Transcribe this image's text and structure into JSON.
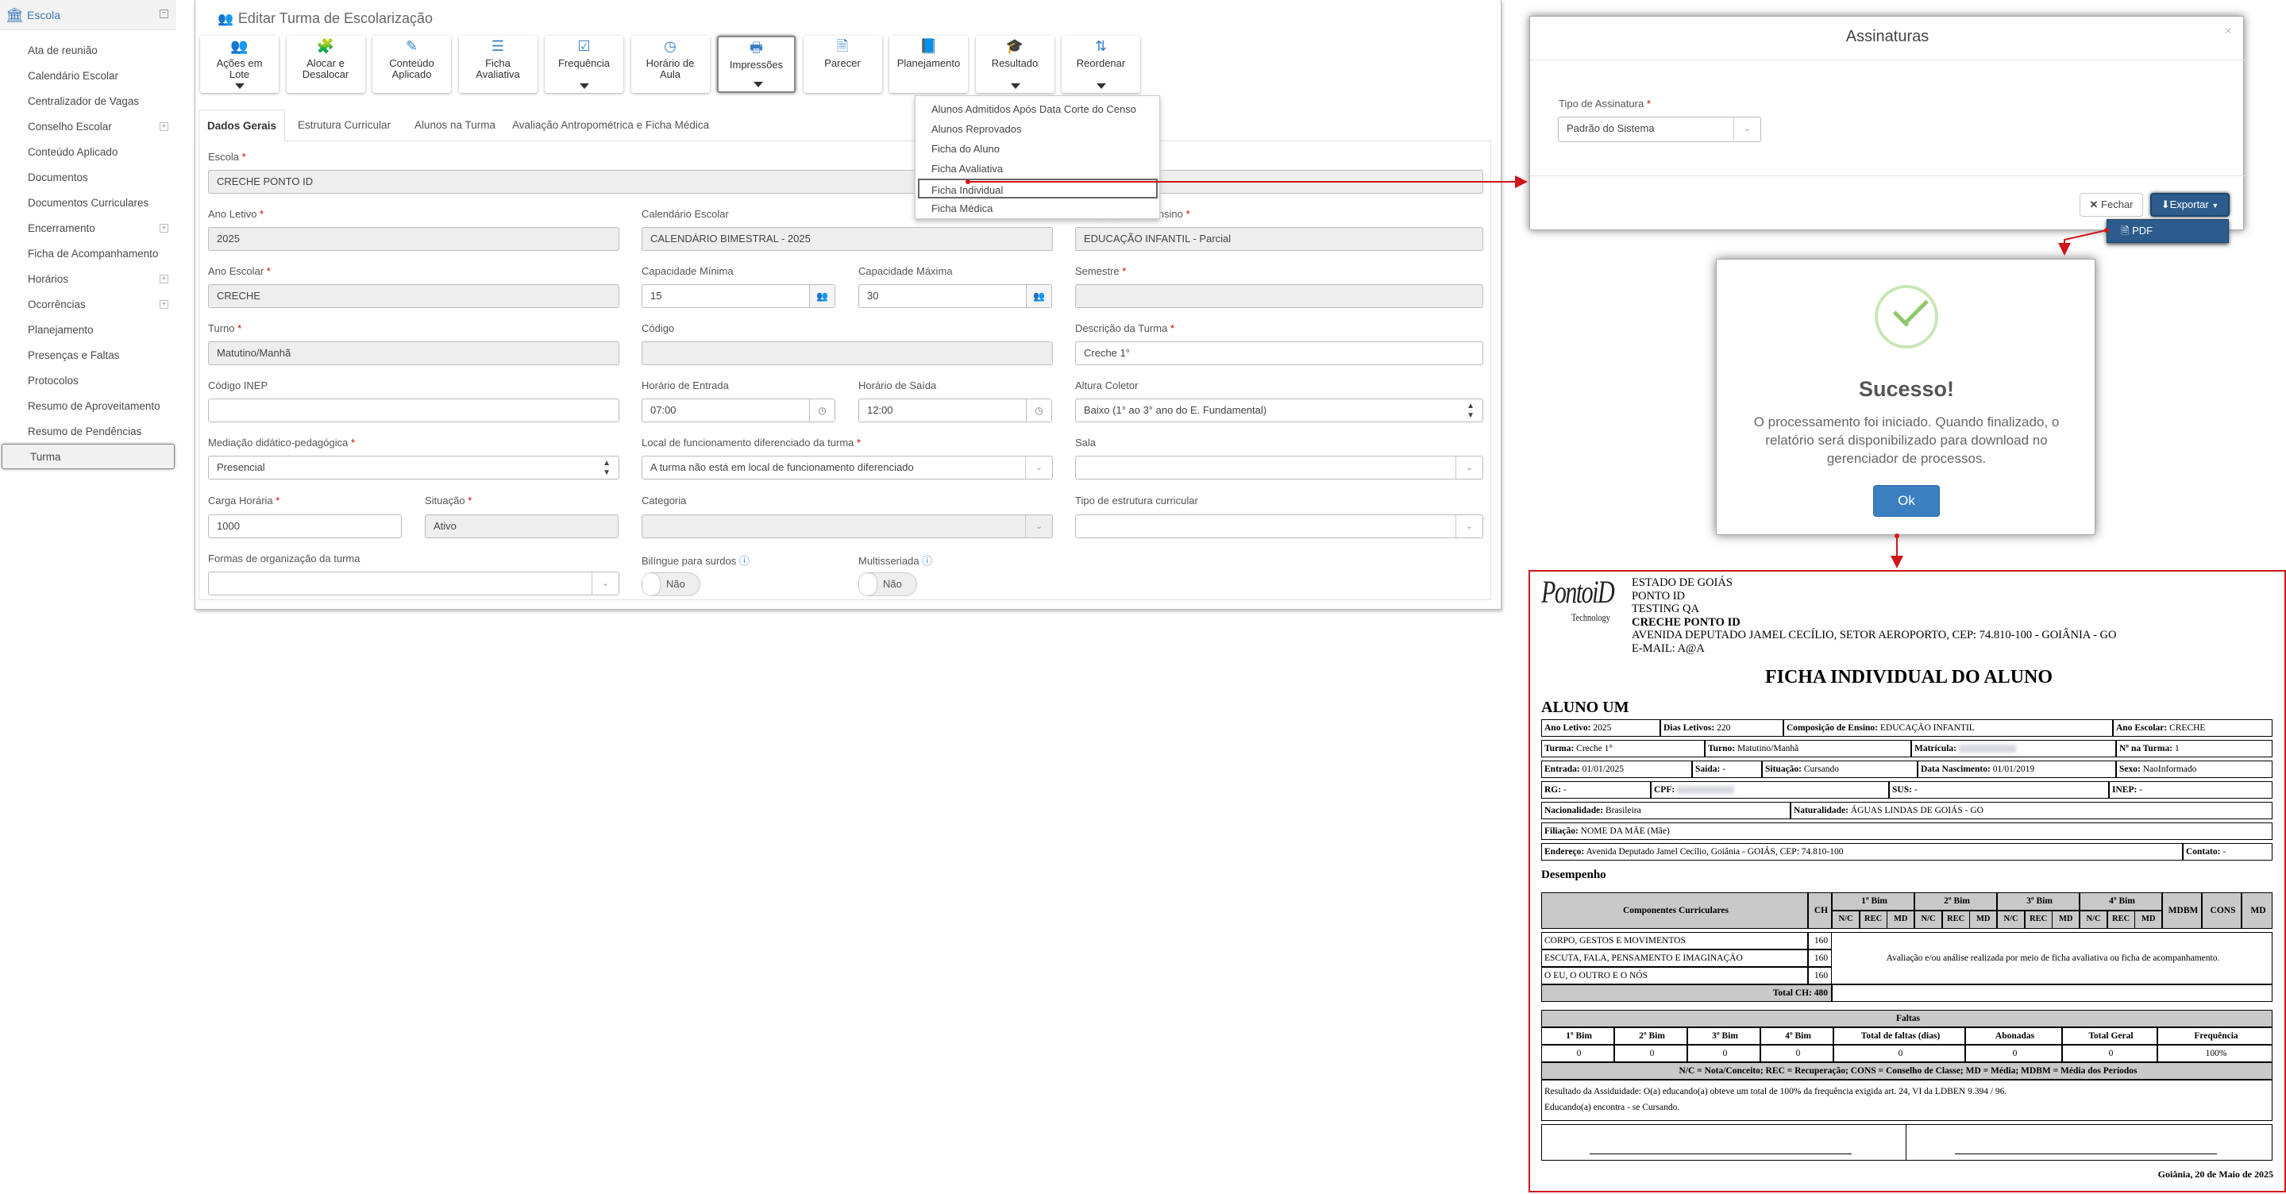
{
  "sidebar": {
    "header": "Escola",
    "items": [
      {
        "label": "Ata de reunião",
        "expandable": false
      },
      {
        "label": "Calendário Escolar",
        "expandable": false
      },
      {
        "label": "Centralizador de Vagas",
        "expandable": false
      },
      {
        "label": "Conselho Escolar",
        "expandable": true
      },
      {
        "label": "Conteúdo Aplicado",
        "expandable": false
      },
      {
        "label": "Documentos",
        "expandable": false
      },
      {
        "label": "Documentos Curriculares",
        "expandable": false
      },
      {
        "label": "Encerramento",
        "expandable": true
      },
      {
        "label": "Ficha de Acompanhamento",
        "expandable": false
      },
      {
        "label": "Horários",
        "expandable": true
      },
      {
        "label": "Ocorrências",
        "expandable": true
      },
      {
        "label": "Planejamento",
        "expandable": false
      },
      {
        "label": "Presenças e Faltas",
        "expandable": false
      },
      {
        "label": "Protocolos",
        "expandable": false
      },
      {
        "label": "Resumo de Aproveitamento",
        "expandable": false
      },
      {
        "label": "Resumo de Pendências",
        "expandable": false
      },
      {
        "label": "Turma",
        "expandable": false,
        "active": true
      }
    ]
  },
  "page": {
    "title": "Editar Turma de Escolarização"
  },
  "toolbar": [
    {
      "l1": "Ações em",
      "l2": "Lote",
      "icon": "users-icon",
      "caret": true
    },
    {
      "l1": "Alocar e",
      "l2": "Desalocar",
      "icon": "puzzle-icon",
      "caret": false
    },
    {
      "l1": "Conteúdo",
      "l2": "Aplicado",
      "icon": "pencil-icon",
      "caret": false
    },
    {
      "l1": "Ficha",
      "l2": "Avaliativa",
      "icon": "list-icon",
      "caret": false
    },
    {
      "l1": "Frequência",
      "l2": "",
      "icon": "check-square-icon",
      "caret": true
    },
    {
      "l1": "Horário de",
      "l2": "Aula",
      "icon": "clock-icon",
      "caret": false
    },
    {
      "l1": "Impressões",
      "l2": "",
      "icon": "printer-icon",
      "caret": true,
      "selected": true
    },
    {
      "l1": "Parecer",
      "l2": "",
      "icon": "document-icon",
      "caret": false
    },
    {
      "l1": "Planejamento",
      "l2": "",
      "icon": "book-icon",
      "caret": false
    },
    {
      "l1": "Resultado",
      "l2": "",
      "icon": "graduation-cap-icon",
      "caret": true
    },
    {
      "l1": "Reordenar",
      "l2": "",
      "icon": "sort-az-icon",
      "caret": true
    }
  ],
  "tabs": [
    "Dados Gerais",
    "Estrutura Curricular",
    "Alunos na Turma",
    "Avaliação Antropométrica e Ficha Médica"
  ],
  "dropdown": [
    "Alunos Admitidos Após Data Corte do Censo",
    "Alunos Reprovados",
    "Ficha do Aluno",
    "Ficha Avaliativa",
    "Ficha Individual",
    "Ficha Médica"
  ],
  "form": {
    "escola": {
      "label": "Escola",
      "value": "CRECHE PONTO ID"
    },
    "ano_letivo": {
      "label": "Ano Letivo",
      "value": "2025"
    },
    "calendario": {
      "label": "Calendário Escolar",
      "value": "CALENDÁRIO BIMESTRAL - 2025"
    },
    "composicao": {
      "label": "Composição De Ensino",
      "value": "EDUCAÇÃO INFANTIL - Parcial"
    },
    "ano_escolar": {
      "label": "Ano Escolar",
      "value": "CRECHE"
    },
    "cap_min": {
      "label": "Capacidade Mínima",
      "value": "15"
    },
    "cap_max": {
      "label": "Capacidade Máxima",
      "value": "30"
    },
    "semestre": {
      "label": "Semestre",
      "value": ""
    },
    "turno": {
      "label": "Turno",
      "value": "Matutino/Manhã"
    },
    "codigo": {
      "label": "Código",
      "value": ""
    },
    "descricao": {
      "label": "Descrição da Turma",
      "value": "Creche 1°"
    },
    "inep": {
      "label": "Código INEP",
      "value": ""
    },
    "h_entrada": {
      "label": "Horário de Entrada",
      "value": "07:00"
    },
    "h_saida": {
      "label": "Horário de Saída",
      "value": "12:00"
    },
    "altura": {
      "label": "Altura Coletor",
      "value": "Baixo (1° ao 3° ano do E. Fundamental)"
    },
    "mediacao": {
      "label": "Mediação didático-pedagógica",
      "value": "Presencial"
    },
    "local": {
      "label": "Local de funcionamento diferenciado da turma",
      "value": "A turma não está em local de funcionamento diferenciado"
    },
    "sala": {
      "label": "Sala",
      "value": ""
    },
    "carga": {
      "label": "Carga Horária",
      "value": "1000"
    },
    "situacao": {
      "label": "Situação",
      "value": "Ativo"
    },
    "categoria": {
      "label": "Categoria",
      "value": ""
    },
    "tipo_estrutura": {
      "label": "Tipo de estrutura curricular",
      "value": ""
    },
    "formas": {
      "label": "Formas de organização da turma",
      "value": ""
    },
    "bilingue": {
      "label": "Bilíngue para surdos",
      "value": "Não"
    },
    "multisseriada": {
      "label": "Multisseriada",
      "value": "Não"
    }
  },
  "modal_assinaturas": {
    "title": "Assinaturas",
    "close": "×",
    "tipo_label": "Tipo de Assinatura",
    "tipo_value": "Padrão do Sistema",
    "fechar": "Fechar",
    "exportar": "Exportar",
    "pdf": "PDF"
  },
  "modal_sucesso": {
    "title": "Sucesso!",
    "message": "O processamento foi iniciado. Quando finalizado, o relatório será disponibilizado para download no gerenciador de processos.",
    "ok": "Ok"
  },
  "report": {
    "logo1": "PontoiD",
    "logo2": "Technology",
    "header": [
      "ESTADO DE GOIÁS",
      "PONTO ID",
      "TESTING QA",
      "CRECHE PONTO ID",
      "AVENIDA DEPUTADO JAMEL CECÍLIO, SETOR AEROPORTO, CEP: 74.810-100 - GOIÂNIA - GO",
      "E-MAIL: A@A"
    ],
    "title": "FICHA INDIVIDUAL DO ALUNO",
    "student": "ALUNO UM",
    "info": {
      "ano_letivo": [
        "Ano Letivo:",
        "2025"
      ],
      "dias": [
        "Dias Letivos:",
        "220"
      ],
      "comp": [
        "Composição de Ensino:",
        "EDUCAÇÃO INFANTIL"
      ],
      "ano_esc": [
        "Ano Escolar:",
        "CRECHE"
      ],
      "turma": [
        "Turma:",
        "Creche 1°"
      ],
      "turno": [
        "Turno:",
        "Matutino/Manhã"
      ],
      "matricula": [
        "Matrícula:",
        ""
      ],
      "numero": [
        "Nº na Turma:",
        "1"
      ],
      "entrada": [
        "Entrada:",
        "01/01/2025"
      ],
      "saida": [
        "Saída:",
        "-"
      ],
      "situacao": [
        "Situação:",
        "Cursando"
      ],
      "nasc": [
        "Data Nascimento:",
        "01/01/2019"
      ],
      "sexo": [
        "Sexo:",
        "NaoInformado"
      ],
      "rg": [
        "RG:",
        "-"
      ],
      "cpf": [
        "CPF:",
        ""
      ],
      "sus": [
        "SUS:",
        "-"
      ],
      "inep": [
        "INEP:",
        "-"
      ],
      "nac": [
        "Nacionalidade:",
        "Brasileira"
      ],
      "nat": [
        "Naturalidade:",
        "ÁGUAS LINDAS DE GOIÁS - GO"
      ],
      "filiacao": [
        "Filiação:",
        "NOME DA MÃE (Mãe)"
      ],
      "endereco": [
        "Endereço:",
        "Avenida Deputado Jamel Cecílio, Goiânia - GOIÁS, CEP: 74.810-100"
      ],
      "contato": [
        "Contato:",
        "-"
      ]
    },
    "desempenho": "Desempenho",
    "perf_head": {
      "comp": "Componentes Curriculares",
      "ch": "CH",
      "bims": [
        "1º Bim",
        "2º Bim",
        "3º Bim",
        "4º Bim"
      ],
      "sub": [
        "N/C",
        "REC",
        "MD"
      ],
      "mdbm": "MDBM",
      "cons": "CONS",
      "md": "MD"
    },
    "components": [
      {
        "name": "CORPO, GESTOS E MOVIMENTOS",
        "ch": "160"
      },
      {
        "name": "ESCUTA, FALA, PENSAMENTO E IMAGINAÇÃO",
        "ch": "160"
      },
      {
        "name": "O EU, O OUTRO E O NÓS",
        "ch": "160"
      }
    ],
    "perf_note": "Avaliação e/ou análise realizada por meio de ficha avaliativa ou ficha de acompanhamento.",
    "total_ch": "Total CH: 480",
    "faltas": {
      "title": "Faltas",
      "headers": [
        "1º Bim",
        "2º Bim",
        "3º Bim",
        "4º Bim",
        "Total de faltas (dias)",
        "Abonadas",
        "Total Geral",
        "Frequência"
      ],
      "values": [
        "0",
        "0",
        "0",
        "0",
        "0",
        "0",
        "0",
        "100%"
      ]
    },
    "legend": "N/C = Nota/Conceito; REC = Recuperação; CONS = Conselho de Classe; MD = Média; MDBM = Média dos Períodos",
    "assiduidade": "Resultado da Assiduidade: O(a) educando(a) obteve um total de 100% da frequência exigida art. 24, VI da LDBEN 9.394 / 96.",
    "situacao_final": "Educando(a) encontra - se Cursando.",
    "date": "Goiânia, 20 de Maio de 2025"
  },
  "colors": {
    "accent": "#3b7fc0",
    "export": "#2c5c8b",
    "arrow": "#d0161b",
    "success": "#90c96b"
  }
}
